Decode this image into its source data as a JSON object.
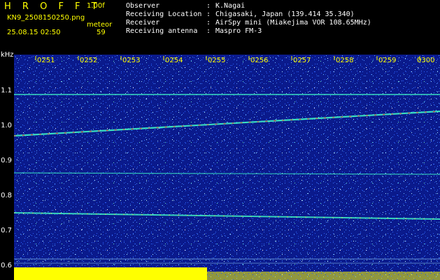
{
  "header": {
    "app_name": "H R O F F T",
    "version": "1.00f",
    "filename": "KN9_2508150250.png",
    "datetime": "25.08.15 02:50",
    "meteor_label": "meteor",
    "meteor_count": "59"
  },
  "info": [
    {
      "label": "Observer",
      "value": "K.Nagai"
    },
    {
      "label": "Receiving Location",
      "value": "Chigasaki, Japan (139.414 35.340)"
    },
    {
      "label": "Receiver",
      "value": "AirSpy mini (Miakejima VOR 108.65MHz)"
    },
    {
      "label": "Receiving antenna",
      "value": "Maspro FM-3"
    }
  ],
  "axis": {
    "unit": "kHz",
    "freq_labels": [
      "1.1",
      "1.0",
      "0.9",
      "0.8",
      "0.7",
      "0.6"
    ],
    "time_labels": [
      "0251",
      "0252",
      "0253",
      "0254",
      "0255",
      "0256",
      "0257",
      "0258",
      "0259",
      "0300"
    ]
  },
  "colors": {
    "background": "#000000",
    "header_yellow": "#ffff00",
    "spectrogram_bg": "#0a1a8c",
    "noise": "#2a5cff",
    "signal_cyan": "#40ffc8",
    "signal_red": "#ff3020",
    "bottom_band": "#ffff00"
  }
}
